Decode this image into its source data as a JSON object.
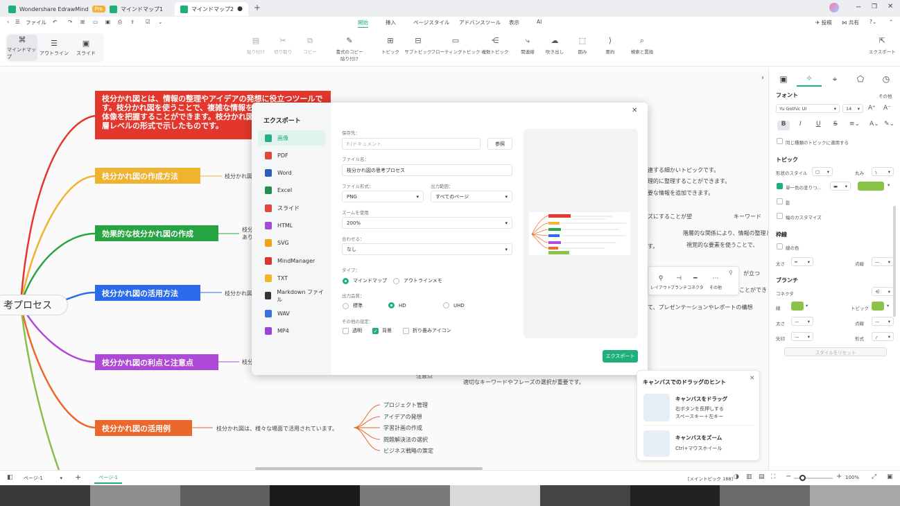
{
  "titlebar": {
    "tabs": [
      {
        "label": "Wondershare EdrawMind",
        "badge": "Pro"
      },
      {
        "label": "マインドマップ1"
      },
      {
        "label": "マインドマップ2"
      }
    ],
    "new_tab": "+"
  },
  "menubar": {
    "file": "ファイル",
    "tabs": [
      "開始",
      "挿入",
      "ページスタイル",
      "アドバンスツール",
      "表示",
      "AI"
    ],
    "right": [
      "投稿",
      "共有"
    ]
  },
  "views": [
    "マインドマップ",
    "アウトライン",
    "スライド"
  ],
  "ribbon": {
    "items": [
      {
        "label": "貼り付け",
        "icon": "paste-icon",
        "glyph": "▤",
        "disabled": true
      },
      {
        "label": "切り取り",
        "icon": "cut-icon",
        "glyph": "✂",
        "disabled": true
      },
      {
        "label": "コピー",
        "icon": "copy-icon",
        "glyph": "⧉",
        "disabled": true
      },
      {
        "label": "書式のコピー\n貼り付け",
        "icon": "format-painter-icon",
        "glyph": "✎",
        "disabled": false
      },
      {
        "label": "トピック",
        "icon": "topic-icon",
        "glyph": "⊞",
        "disabled": false
      },
      {
        "label": "サブトピック",
        "icon": "subtopic-icon",
        "glyph": "⊟",
        "disabled": false
      },
      {
        "label": "フローティングトピック",
        "icon": "floating-topic-icon",
        "glyph": "▭",
        "disabled": false
      },
      {
        "label": "複数トピック",
        "icon": "multi-topic-icon",
        "glyph": "⋲",
        "disabled": false
      },
      {
        "label": "関連線",
        "icon": "relation-line-icon",
        "glyph": "⤷",
        "disabled": false
      },
      {
        "label": "吹き出し",
        "icon": "callout-icon",
        "glyph": "☁",
        "disabled": false
      },
      {
        "label": "囲み",
        "icon": "boundary-icon",
        "glyph": "⬚",
        "disabled": false
      },
      {
        "label": "要約",
        "icon": "summary-icon",
        "glyph": "⟩",
        "disabled": false
      },
      {
        "label": "検索と置換",
        "icon": "find-replace-icon",
        "glyph": "⌕",
        "disabled": false
      }
    ],
    "export": "エクスポート"
  },
  "canvas": {
    "central": "考プロセス",
    "branches": [
      {
        "text": "枝分かれ図とは、情報の整理やアイデアの発想に役立つツールです。枝分かれ図を使うことで、複雑な情報を整理し、全体から全体像を把握することができます。枝分かれ図の思考プロセスを多層レベルの形式で示したものです。",
        "color": "#e8392e"
      },
      {
        "text": "枝分かれ図の作成方法",
        "color": "#f5b731"
      },
      {
        "text": "効果的な枝分かれ図の作成",
        "color": "#27a844"
      },
      {
        "text": "枝分かれ図の活用方法",
        "color": "#2a6ef0"
      },
      {
        "text": "枝分かれ図の利点と注意点",
        "color": "#b14bdb"
      },
      {
        "text": "枝分かれ図の活用例",
        "color": "#f06a2b"
      }
    ],
    "sub_texts": [
      "枝分かれ図",
      "枝分",
      "あり",
      "枝分かれ図",
      "枝分",
      "枝分かれ図は、様々な場面で活用されています。"
    ],
    "right_texts": [
      "連する細かいトピックです。",
      "理的に整理することができます。",
      "要な情報を追加できます。",
      "ズにすることが望",
      "キーワード",
      "階層的な関係により、情報の整理と",
      "す。",
      "視覚的な要素を使うことで、",
      "が立つ",
      "ことができ",
      "て、プレゼンテーションやレポートの構想",
      "注意点",
      "適切なキーワードやフレーズの選択が重要です。"
    ],
    "examples": [
      "プロジェクト管理",
      "アイデアの発想",
      "学習計画の作成",
      "問題解決法の選択",
      "ビジネス戦略の策定"
    ]
  },
  "floatbar": [
    "レイアウト",
    "ブランチ",
    "コネクタ",
    "その他"
  ],
  "dialog": {
    "title": "エクスポート",
    "formats": [
      {
        "label": "画像",
        "color": "#23b088"
      },
      {
        "label": "PDF",
        "color": "#e0463c"
      },
      {
        "label": "Word",
        "color": "#2b5eb8"
      },
      {
        "label": "Excel",
        "color": "#1f8f4c"
      },
      {
        "label": "スライド",
        "color": "#e0463c"
      },
      {
        "label": "HTML",
        "color": "#a24bd6"
      },
      {
        "label": "SVG",
        "color": "#f0a01c"
      },
      {
        "label": "MindManager",
        "color": "#d9362f"
      },
      {
        "label": "TXT",
        "color": "#f2b42b"
      },
      {
        "label": "Markdown ファイル",
        "color": "#333333"
      },
      {
        "label": "WAV",
        "color": "#3b6fe0"
      },
      {
        "label": "MP4",
        "color": "#9b43d6"
      }
    ],
    "save_label": "保存先：",
    "save_placeholder": "F:/ドキュメント",
    "browse": "参照",
    "filename_label": "ファイル名：",
    "filename": "枝分かれ図の思考プロセス",
    "filetype_label": "ファイル形式：",
    "filetype": "PNG",
    "range_label": "出力範囲：",
    "range": "すべてのページ",
    "zoom_label": "ズームを使用",
    "zoom": "200%",
    "fit_label": "合わせる：",
    "fit": "なし",
    "type_label": "タイプ：",
    "types": [
      "マインドマップ",
      "アウトラインメモ"
    ],
    "quality_label": "出力品質：",
    "qualities": [
      "標準",
      "HD",
      "UHD"
    ],
    "other_label": "その他の設定：",
    "others": [
      "透明",
      "背景",
      "折り畳みアイコン"
    ],
    "export_button": "エクスポート",
    "close": "✕"
  },
  "panel": {
    "font_header": "フォント",
    "font_more": "その他",
    "font_name": "Yu Gothic UI",
    "font_size": "14",
    "apply_same": "同じ種類のトピックに適用する",
    "topic_header": "トピック",
    "shape_style": "形状のスタイル",
    "rounded": "丸み",
    "single_fill": "単一色の塗りつ...",
    "shadow": "影",
    "width_custom": "幅のカスタマイズ",
    "border_header": "枠線",
    "line_color": "線の色",
    "thickness": "太さ",
    "dash": "点線",
    "branch_header": "ブランチ",
    "connector": "コネクタ",
    "line": "線",
    "topic": "トピック",
    "thickness2": "太さ",
    "dash2": "点線",
    "arrow": "矢印",
    "shape": "形式",
    "reset": "スタイルをリセット"
  },
  "hint": {
    "title": "キャンバスでのドラッグのヒント",
    "items": [
      {
        "title": "キャンバスをドラッグ",
        "desc1": "右ボタンを長押しする",
        "desc2": "スペースキー＋左キー"
      },
      {
        "title": "キャンバスをズーム",
        "desc1": "Ctrl+マウスホイール",
        "desc2": ""
      }
    ]
  },
  "status": {
    "page_select": "ページ-1",
    "page_tab": "ページ-1",
    "topic_count": "[メイントピック 188]",
    "zoom": "100%"
  },
  "colors": {
    "accent": "#1fb07a"
  }
}
